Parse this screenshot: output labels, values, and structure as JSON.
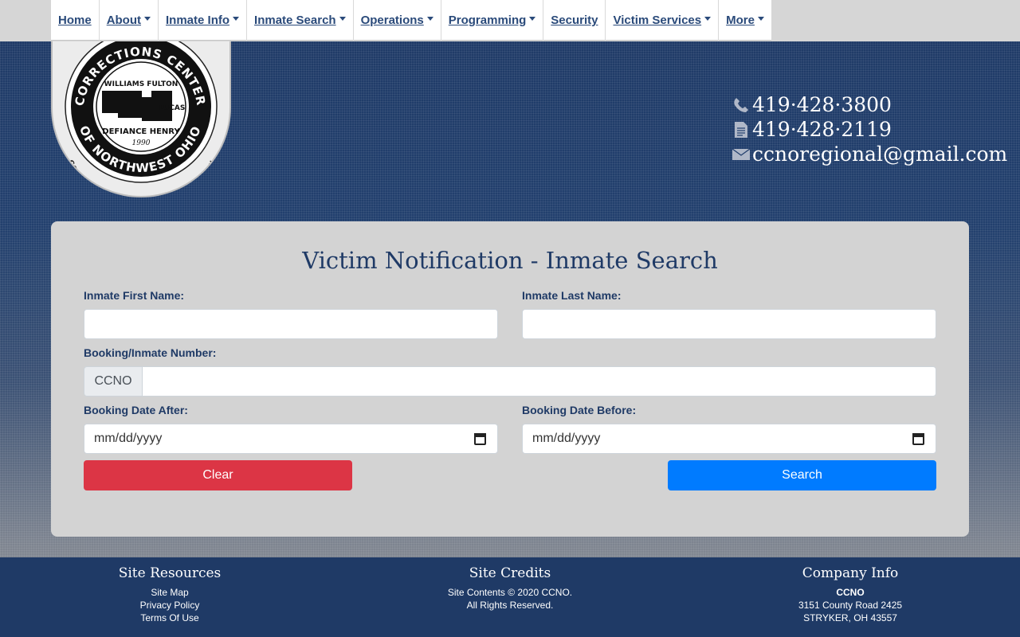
{
  "nav": {
    "items": [
      {
        "label": "Home",
        "dropdown": false
      },
      {
        "label": "About",
        "dropdown": true
      },
      {
        "label": "Inmate Info",
        "dropdown": true
      },
      {
        "label": "Inmate Search",
        "dropdown": true
      },
      {
        "label": "Operations",
        "dropdown": true
      },
      {
        "label": "Programming",
        "dropdown": true
      },
      {
        "label": "Security",
        "dropdown": false
      },
      {
        "label": "Victim Services",
        "dropdown": true
      },
      {
        "label": "More",
        "dropdown": true
      }
    ]
  },
  "logo": {
    "ring_top": "CORRECTIONS CENTER",
    "ring_bottom": "OF NORTHWEST OHIO",
    "motto": "CORRECTIONS · SERVICE · COOPERATION",
    "counties_top": "WILLIAMS FULTON",
    "county_right": "LUCAS",
    "counties_bottom": "DEFIANCE HENRY",
    "year": "1990"
  },
  "contact": {
    "phone": "419·428·3800",
    "fax": "419·428·2119",
    "email": "ccnoregional@gmail.com"
  },
  "form": {
    "title": "Victim Notification - Inmate Search",
    "first_name_label": "Inmate First Name:",
    "last_name_label": "Inmate Last Name:",
    "booking_label": "Booking/Inmate Number:",
    "booking_prefix": "CCNO",
    "date_after_label": "Booking Date After:",
    "date_before_label": "Booking Date Before:",
    "date_placeholder": "mm/dd/yyyy",
    "clear_label": "Clear",
    "search_label": "Search"
  },
  "footer": {
    "resources": {
      "title": "Site Resources",
      "links": [
        "Site Map",
        "Privacy Policy",
        "Terms Of Use"
      ]
    },
    "credits": {
      "title": "Site Credits",
      "lines": [
        "Site Contents © 2020 CCNO.",
        "All Rights Reserved."
      ]
    },
    "company": {
      "title": "Company Info",
      "name": "CCNO",
      "address1": "3151 County Road 2425",
      "address2": "STRYKER, OH 43557"
    }
  },
  "colors": {
    "nav_text": "#2a4a7a",
    "accent": "#1f3a66",
    "clear": "#dc3545",
    "search": "#007bff"
  }
}
